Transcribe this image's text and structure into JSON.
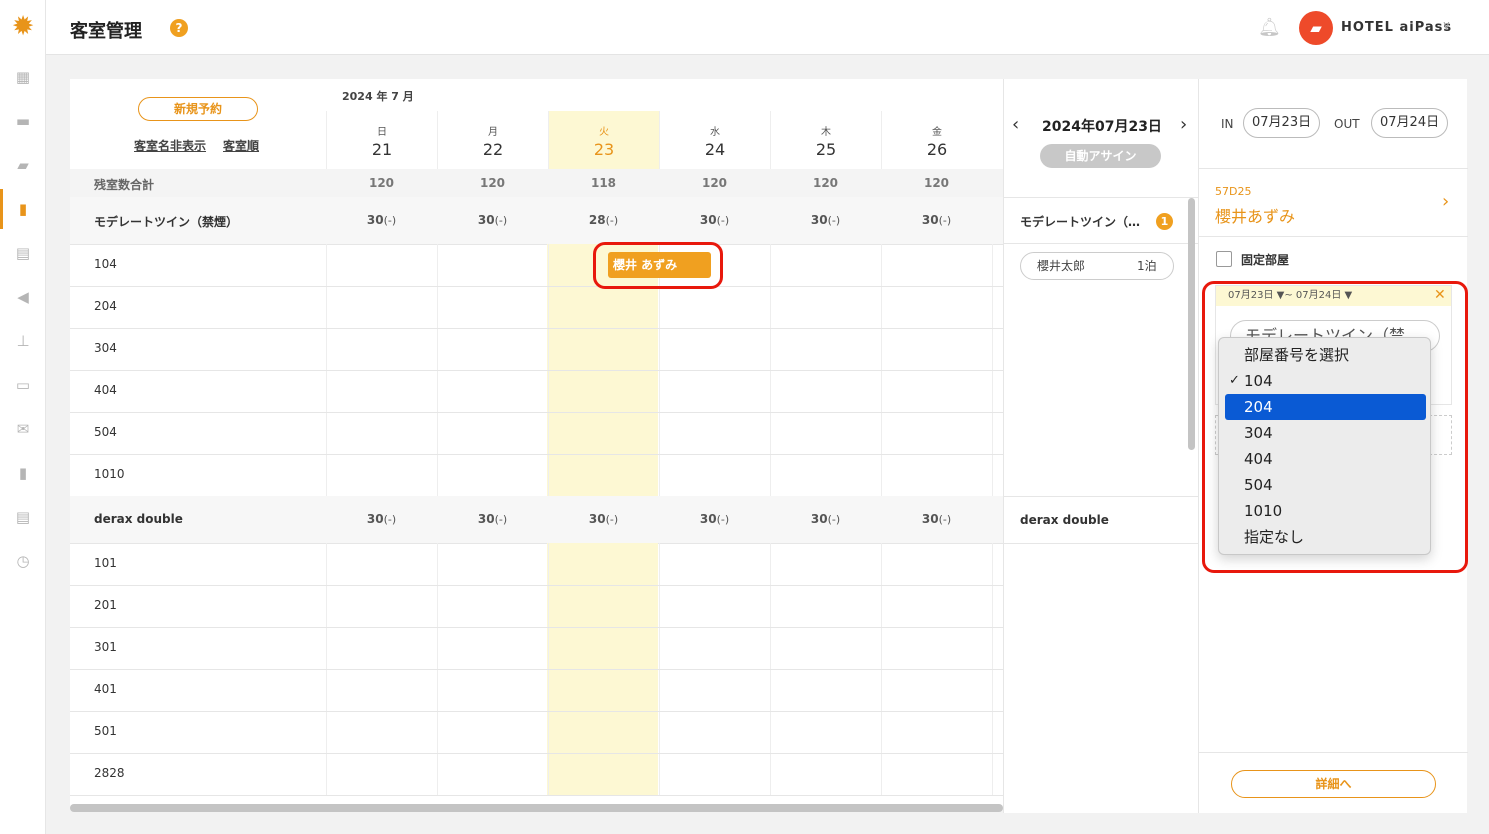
{
  "header": {
    "title": "客室管理",
    "help": "?",
    "hotel": "HOTEL aiPass"
  },
  "calendar": {
    "new_booking": "新規予約",
    "hide_names": "客室名非表示",
    "room_order": "客室順",
    "month": "2024 年 7 月",
    "days": [
      {
        "wd": "日",
        "d": "21"
      },
      {
        "wd": "月",
        "d": "22"
      },
      {
        "wd": "火",
        "d": "23"
      },
      {
        "wd": "水",
        "d": "24"
      },
      {
        "wd": "木",
        "d": "25"
      },
      {
        "wd": "金",
        "d": "26"
      }
    ],
    "total_label": "残室数合計",
    "totals": [
      "120",
      "120",
      "118",
      "120",
      "120",
      "120"
    ],
    "groups": [
      {
        "name": "モデレートツイン（禁煙）",
        "vals": [
          "30",
          "30",
          "28",
          "30",
          "30",
          "30"
        ],
        "rooms": [
          "104",
          "204",
          "304",
          "404",
          "504",
          "1010"
        ]
      },
      {
        "name": "derax double",
        "vals": [
          "30",
          "30",
          "30",
          "30",
          "30",
          "30"
        ],
        "rooms": [
          "101",
          "201",
          "301",
          "401",
          "501",
          "2828"
        ]
      }
    ],
    "val_suffix": "(-)",
    "reservation": "櫻井 あずみ"
  },
  "unassigned": {
    "date": "2024年07月23日",
    "auto_assign": "自動アサイン",
    "type1": "モデレートツイン（…",
    "type1_count": "1",
    "guest": "櫻井太郎",
    "stay": "1泊",
    "type2": "derax double"
  },
  "detail": {
    "in_label": "IN",
    "in_date": "07月23日",
    "out_label": "OUT",
    "out_date": "07月24日",
    "code": "57D25",
    "name": "櫻井あずみ",
    "fixed_room": "固定部屋",
    "range": "07月23日 ▼~ 07月24日 ▼",
    "room_type": "モデレートツイン（禁",
    "detail_btn": "詳細へ"
  },
  "dropdown": {
    "options": [
      "部屋番号を選択",
      "104",
      "204",
      "304",
      "404",
      "504",
      "1010",
      "指定なし"
    ],
    "checked": "104",
    "highlighted": "204"
  },
  "colors": {
    "accent": "#e8941a",
    "today": "#fdf8d3",
    "highlight": "#e8180c",
    "select": "#0a5ad4"
  }
}
